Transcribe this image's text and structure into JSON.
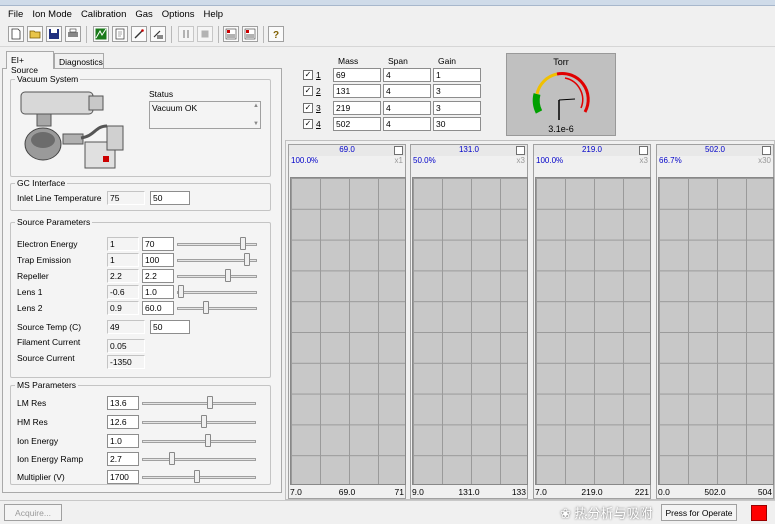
{
  "menu": [
    "File",
    "Ion Mode",
    "Calibration",
    "Gas",
    "Options",
    "Help"
  ],
  "tabs": [
    "EI+ Source",
    "Diagnostics"
  ],
  "vacuum": {
    "title": "Vacuum System",
    "status_label": "Status",
    "status_value": "Vacuum OK"
  },
  "gc": {
    "title": "GC Interface",
    "label": "Inlet Line Temperature",
    "actual": "75",
    "setpoint": "50"
  },
  "source": {
    "title": "Source Parameters",
    "rows": [
      {
        "label": "Electron Energy",
        "actual": "1",
        "set": "70",
        "level": 0.85
      },
      {
        "label": "Trap Emission",
        "actual": "1",
        "set": "100",
        "level": 0.9
      },
      {
        "label": "Repeller",
        "actual": "2.2",
        "set": "2.2",
        "level": 0.65
      },
      {
        "label": "Lens 1",
        "actual": "-0.6",
        "set": "1.0",
        "level": 0.02
      },
      {
        "label": "Lens 2",
        "actual": "0.9",
        "set": "60.0",
        "level": 0.35
      }
    ],
    "source_temp_label": "Source Temp (C)",
    "source_temp_actual": "49",
    "source_temp_set": "50",
    "filament_label": "Filament Current",
    "filament_value": "0.05",
    "source_current_label": "Source Current",
    "source_current_value": "-1350"
  },
  "ms": {
    "title": "MS Parameters",
    "rows": [
      {
        "label": "LM Res",
        "value": "13.6",
        "level": 0.6
      },
      {
        "label": "HM Res",
        "value": "12.6",
        "level": 0.55
      },
      {
        "label": "Ion Energy",
        "value": "1.0",
        "level": 0.58
      },
      {
        "label": "Ion Energy Ramp",
        "value": "2.7",
        "level": 0.25
      },
      {
        "label": "Multiplier (V)",
        "value": "1700",
        "level": 0.48
      }
    ]
  },
  "channels": {
    "headers": [
      "Mass",
      "Span",
      "Gain"
    ],
    "rows": [
      {
        "num": "1",
        "mass": "69",
        "span": "4",
        "gain": "1",
        "checked": true
      },
      {
        "num": "2",
        "mass": "131",
        "span": "4",
        "gain": "3",
        "checked": true
      },
      {
        "num": "3",
        "mass": "219",
        "span": "4",
        "gain": "3",
        "checked": true
      },
      {
        "num": "4",
        "mass": "502",
        "span": "4",
        "gain": "30",
        "checked": true
      }
    ]
  },
  "gauge": {
    "title": "Torr",
    "value": "3.1e-6"
  },
  "panes": [
    {
      "mass": "69.0",
      "pct": "100.0%",
      "gain": "x1",
      "xmin": "7.0",
      "xmid": "69.0",
      "xmax": "71"
    },
    {
      "mass": "131.0",
      "pct": "50.0%",
      "gain": "x3",
      "xmin": "9.0",
      "xmid": "131.0",
      "xmax": "133"
    },
    {
      "mass": "219.0",
      "pct": "100.0%",
      "gain": "x3",
      "xmin": "7.0",
      "xmid": "219.0",
      "xmax": "221"
    },
    {
      "mass": "502.0",
      "pct": "66.7%",
      "gain": "x30",
      "xmin": "0.0",
      "xmid": "502.0",
      "xmax": "504"
    }
  ],
  "buttons": {
    "acquire": "Acquire...",
    "operate": "Press for Operate"
  },
  "watermark": "热分析与吸附",
  "colors": {
    "operate_indicator": "#ff0000",
    "gauge_green": "#00a000",
    "gauge_yellow": "#f0c000",
    "gauge_red": "#e00000",
    "pane_text": "#0000c8"
  }
}
